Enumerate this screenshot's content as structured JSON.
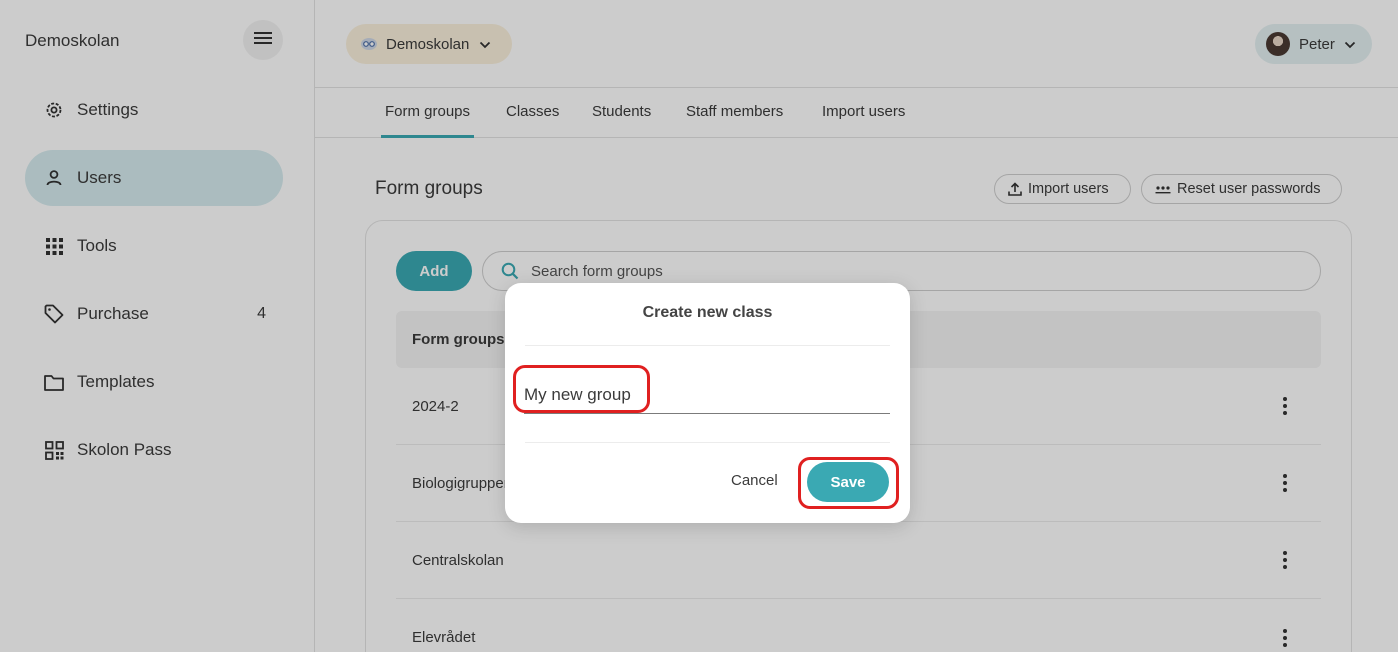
{
  "sidebar": {
    "brand": "Demoskolan",
    "items": [
      {
        "label": "Settings",
        "icon": "gear-icon"
      },
      {
        "label": "Users",
        "icon": "person-icon",
        "active": true
      },
      {
        "label": "Tools",
        "icon": "grid-icon"
      },
      {
        "label": "Purchase",
        "icon": "tag-icon",
        "badge": "4"
      },
      {
        "label": "Templates",
        "icon": "folder-icon"
      },
      {
        "label": "Skolon Pass",
        "icon": "qr-code-icon"
      }
    ]
  },
  "topbar": {
    "school": "Demoskolan",
    "user": "Peter"
  },
  "tabs": [
    "Form groups",
    "Classes",
    "Students",
    "Staff members",
    "Import users"
  ],
  "content": {
    "title": "Form groups",
    "import_users_label": "Import users",
    "reset_passwords_label": "Reset user passwords",
    "add_label": "Add",
    "search_placeholder": "Search form groups",
    "table_header": "Form groups",
    "rows": [
      "2024-2",
      "Biologigruppen",
      "Centralskolan",
      "Elevrådet"
    ]
  },
  "dialog": {
    "title": "Create new class",
    "input_value": "My new group",
    "cancel_label": "Cancel",
    "save_label": "Save"
  },
  "colors": {
    "accent": "#3aa9b3",
    "active_nav": "#d6ecef",
    "annotation": "#e02020"
  }
}
